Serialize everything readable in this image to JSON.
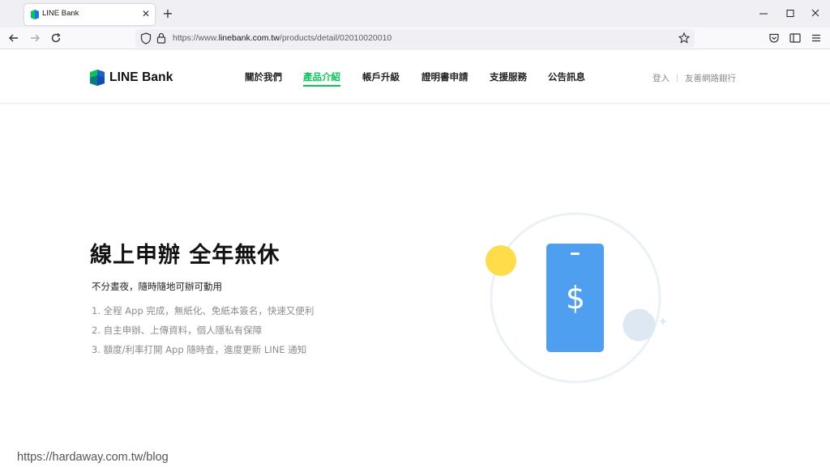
{
  "browser": {
    "tab_title": "LINE Bank",
    "tab_close": "✕",
    "new_tab": "+",
    "url_prefix": "https://www.",
    "url_host": "linebank.com.tw",
    "url_path": "/products/detail/02010020010"
  },
  "header": {
    "logo_text": "LINE Bank",
    "nav": [
      "關於我們",
      "產品介紹",
      "帳戶升級",
      "證明書申請",
      "支援服務",
      "公告訊息"
    ],
    "active_index": 1,
    "login": "登入",
    "partner": "友善網路銀行"
  },
  "hero": {
    "title": "線上申辦 全年無休",
    "subtitle": "不分晝夜，隨時隨地可辦可動用",
    "list": [
      "1. 全程 App 完成，無紙化、免紙本簽名，快速又便利",
      "2. 自主申辦、上傳資料，個人隱私有保障",
      "3. 額度/利率打開 App 隨時查，進度更新 LINE 通知"
    ]
  },
  "illustration": {
    "phone_symbol": "$",
    "icons": [
      "sun-icon",
      "moon-icon",
      "phone-icon",
      "dollar-icon"
    ]
  },
  "watermark": "https://hardaway.com.tw/blog",
  "colors": {
    "accent": "#06c755",
    "phone": "#4f9ff0",
    "sun": "#ffdc4a",
    "moon": "#dde8f3"
  }
}
